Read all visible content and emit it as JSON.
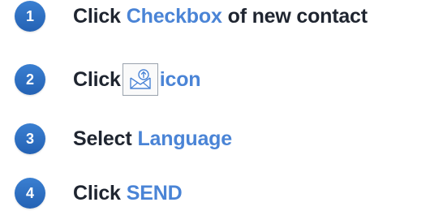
{
  "colors": {
    "badge": "#2f6fc4",
    "text": "#1f2530",
    "highlight": "#4a84d6"
  },
  "steps": [
    {
      "number": "1",
      "verb": "Click",
      "target": "Checkbox",
      "suffix": "of new contact"
    },
    {
      "number": "2",
      "verb": "Click",
      "icon": "envelope-upload-icon",
      "target": "icon"
    },
    {
      "number": "3",
      "verb": "Select",
      "target": "Language"
    },
    {
      "number": "4",
      "verb": "Click",
      "target": "SEND"
    }
  ]
}
